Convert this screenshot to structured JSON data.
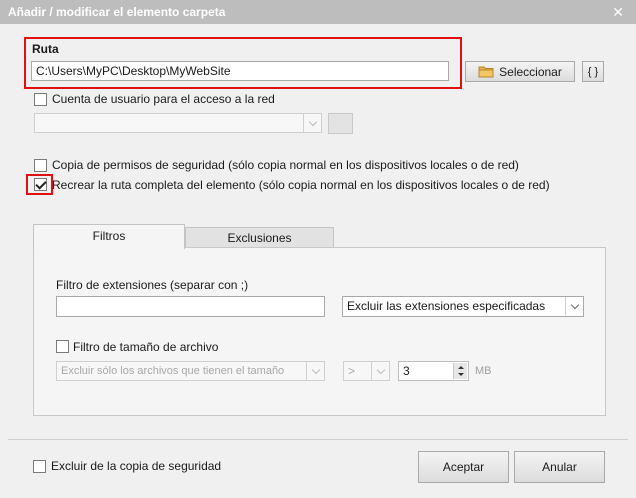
{
  "window": {
    "title": "Añadir / modificar el elemento carpeta",
    "close_glyph": "✕"
  },
  "path": {
    "label": "Ruta",
    "value": "C:\\Users\\MyPC\\Desktop\\MyWebSite",
    "select_button": "Seleccionar",
    "variables_button": "{ }"
  },
  "account": {
    "checkbox_label": "Cuenta de usuario para el acceso a la red",
    "checked": false,
    "combo_value": ""
  },
  "options": {
    "copy_permissions_label": "Copia de permisos de seguridad (sólo copia normal en los dispositivos locales o de red)",
    "copy_permissions_checked": false,
    "recreate_path_label": "Recrear la ruta completa del elemento (sólo copia normal en los dispositivos locales o de red)",
    "recreate_path_checked": true
  },
  "tabs": {
    "filters": "Filtros",
    "exclusions": "Exclusiones",
    "active": "filters"
  },
  "filters": {
    "extensions_label": "Filtro de extensiones (separar con ;)",
    "extensions_value": "",
    "extensions_mode": "Excluir las extensiones especificadas",
    "size_filter_label": "Filtro de tamaño de archivo",
    "size_filter_checked": false,
    "size_mode": "Excluir sólo los archivos que tienen el tamaño",
    "operator": ">",
    "size_value": "3",
    "size_unit": "MB"
  },
  "footer": {
    "exclude_label": "Excluir de la copia de seguridad",
    "exclude_checked": false,
    "accept": "Aceptar",
    "cancel": "Anular"
  },
  "colors": {
    "highlight": "#e01010",
    "titlebar": "#bdbdbd",
    "folder": "#e8b34a"
  },
  "icons": {
    "folder": "folder-icon",
    "close": "close-icon",
    "dropdown": "chevron-down-icon",
    "spinner": "spinner-arrows-icon"
  }
}
